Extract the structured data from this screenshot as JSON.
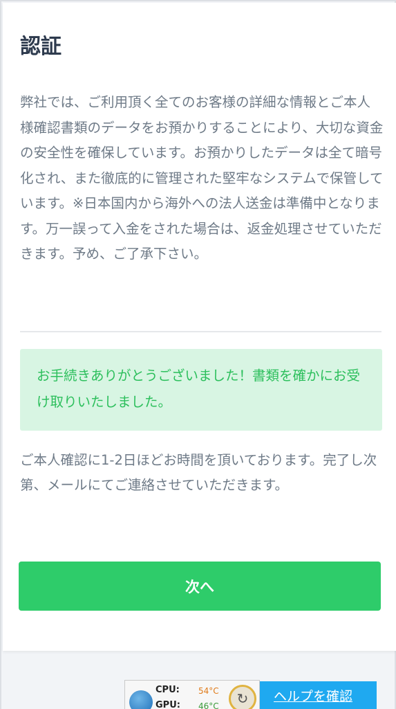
{
  "page": {
    "title": "認証",
    "intro_text": "弊社では、ご利用頂く全てのお客様の詳細な情報とご本人様確認書類のデータをお預かりすることにより、大切な資金の安全性を確保しています。お預かりしたデータは全て暗号化され、また徹底的に管理された堅牢なシステムで保管しています。※日本国内から海外への法人送金は準備中となります。万一誤って入金をされた場合は、返金処理させていただきます。予め、ご了承下さい。"
  },
  "alert": {
    "message": "お手続きありがとうございました！書類を確かにお受け取りいたしました。"
  },
  "notice": {
    "text": "ご本人確認に1-2日ほどお時間を頂いております。完了し次第、メールにてご連絡させていただきます。"
  },
  "next_button": {
    "label": "次へ"
  },
  "system_widget": {
    "cpu_label": "CPU:",
    "cpu_temp": "54°C",
    "gpu_label": "GPU:",
    "gpu_temp": "46°C",
    "refresh_icon": "refresh-icon"
  },
  "help_button": {
    "label": "ヘルプを確認"
  },
  "colors": {
    "primary_green": "#2ecc6a",
    "alert_bg": "#d8f5e3",
    "alert_text": "#2cbf5c",
    "help_blue": "#1fa9f0",
    "title_text": "#2d3a4d",
    "body_text": "#6e7a87"
  }
}
